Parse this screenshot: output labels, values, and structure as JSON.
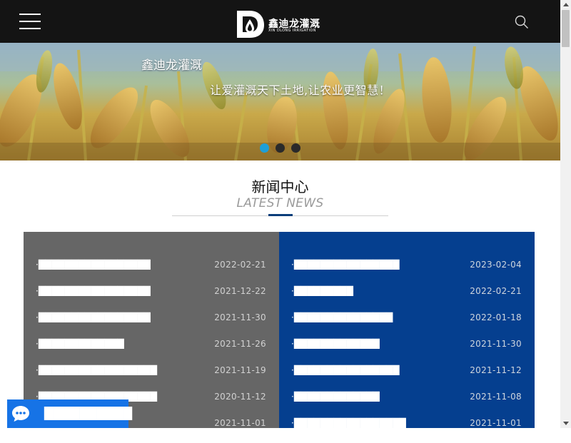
{
  "header": {
    "logo_cn": "鑫迪龙灌溉",
    "logo_en": "XIN DLONG IRRIGATION",
    "menu_icon": "hamburger-icon",
    "search_icon": "search-icon"
  },
  "banner": {
    "title": "鑫迪龙灌溉",
    "slogan": "让爱灌溉天下土地,让农业更智慧！",
    "slides": 3,
    "active_slide": 1
  },
  "section": {
    "title": "新闻中心",
    "subtitle": "LATEST NEWS"
  },
  "news_left": [
    {
      "title": "·█████████████████",
      "date": "2022-02-21"
    },
    {
      "title": "·█████████████████",
      "date": "2021-12-22"
    },
    {
      "title": "·█████████████████",
      "date": "2021-11-30"
    },
    {
      "title": "·█████████████",
      "date": "2021-11-26"
    },
    {
      "title": "·██████████████████",
      "date": "2021-11-19"
    },
    {
      "title": "·██████████████████",
      "date": "2020-11-12"
    },
    {
      "title": "",
      "date": "2021-11-01"
    }
  ],
  "news_right": [
    {
      "title": "·████████████████",
      "date": "2023-02-04"
    },
    {
      "title": "·█████████",
      "date": "2022-02-21"
    },
    {
      "title": "·███████████████",
      "date": "2022-01-18"
    },
    {
      "title": "·█████████████",
      "date": "2021-11-30"
    },
    {
      "title": "·████████████████",
      "date": "2021-11-12"
    },
    {
      "title": "·█████████████",
      "date": "2021-11-08"
    },
    {
      "title": "·█████████████████",
      "date": "2021-11-01"
    }
  ],
  "consult": {
    "label": "██████████",
    "icon": "chat-bubble-icon"
  },
  "colors": {
    "header_bg": "#141414",
    "panel_left": "#666666",
    "panel_right": "#053f8f",
    "dot_active": "#1e9fd8",
    "consult_bg": "#1673e6"
  }
}
